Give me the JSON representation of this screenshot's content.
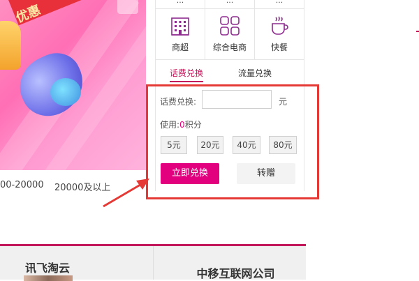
{
  "banner": {
    "ribbon_text": "优惠"
  },
  "range_labels": [
    "00-20000",
    "20000及以上"
  ],
  "grid": {
    "top_row": [
      "...",
      "...",
      "..."
    ],
    "categories": [
      {
        "label": "商超",
        "icon": "building-icon"
      },
      {
        "label": "综合电商",
        "icon": "grid-icon"
      },
      {
        "label": "快餐",
        "icon": "coffee-cup-icon"
      }
    ]
  },
  "tabs": [
    {
      "label": "话费兑换",
      "active": true
    },
    {
      "label": "流量兑换",
      "active": false
    }
  ],
  "form": {
    "recharge_label": "话费兑换:",
    "recharge_value": "",
    "unit": "元",
    "usage_label": "使用:",
    "usage_points": "0",
    "usage_suffix": "积分",
    "amounts": [
      "5元",
      "20元",
      "40元",
      "80元"
    ],
    "submit_label": "立即兑换",
    "gift_label": "转赠"
  },
  "companies": [
    "讯飞淘云",
    "中移互联网公司"
  ],
  "colors": {
    "accent": "#e3007f",
    "annotation": "#e53935",
    "tab_active": "#c2185b"
  }
}
